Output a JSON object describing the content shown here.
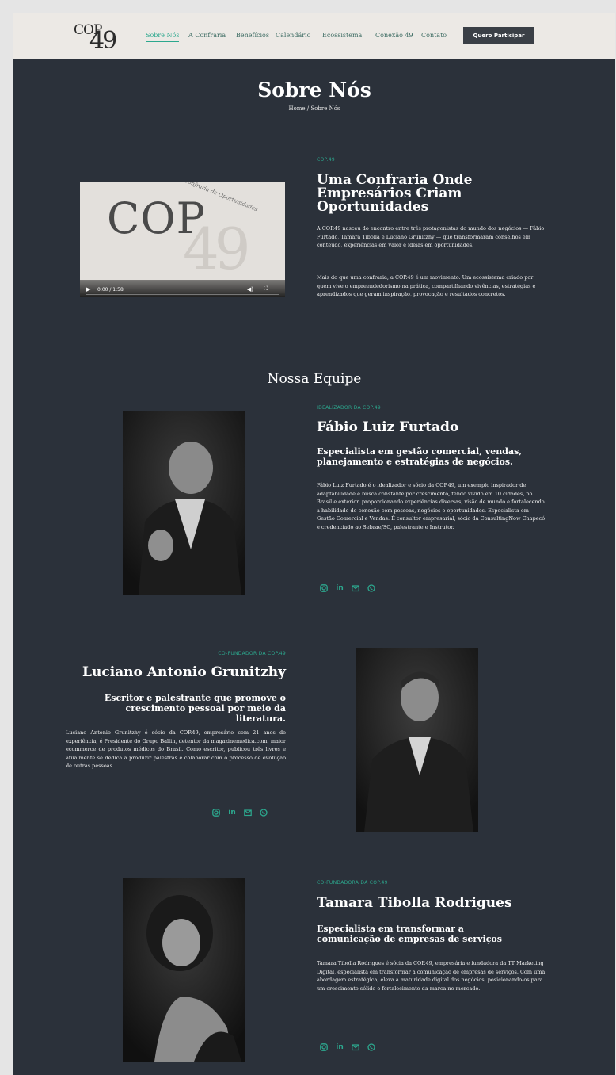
{
  "header": {
    "logo_top": "COP",
    "logo_num": "49",
    "nav": [
      "Sobre Nós",
      "A Confraria",
      "Benefícios",
      "Calendário",
      "Ecossistema",
      "Conexão 49",
      "Contato"
    ],
    "cta": "Quero Participar"
  },
  "hero": {
    "title": "Sobre Nós",
    "breadcrumb": "Home / Sobre Nós"
  },
  "about": {
    "video": {
      "brand_top": "COP",
      "brand_num": "49",
      "script": "Confraria de Oportunidades",
      "time": "0:00 / 1:58",
      "progress": 0
    },
    "eyebrow": "COP.49",
    "title": "Uma Confraria Onde Empresários Criam Oportunidades",
    "p1": "A COP.49 nasceu do encontro entre três protagonistas do mundo dos negócios — Fábio Furtado, Tamara Tibolla e Luciano Grunitzhy — que transformaram conselhos em conteúdo, experiências em valor e ideias em oportunidades.",
    "p2": "Mais do que uma confraria, a COP.49 é um movimento. Um ecossistema criado por quem vive o empreendedorismo na prática, compartilhando vivências, estratégias e aprendizados que geram inspiração, provocação e resultados concretos."
  },
  "team": {
    "title": "Nossa Equipe",
    "members": [
      {
        "role": "IDEALIZADOR DA COP.49",
        "name": "Fábio Luiz Furtado",
        "subtitle": "Especialista em gestão comercial, vendas, planejamento e estratégias de negócios.",
        "bio": "Fábio Luiz Furtado é o idealizador e sócio da COP.49, um exemplo inspirador de adaptabilidade e busca constante por crescimento, tendo vivido em 10 cidades, no Brasil e exterior, proporcionando experiências diversas, visão de mundo e fortalecendo a habilidade de conexão com pessoas, negócios e oportunidades. Especialista em Gestão Comercial e Vendas. É consultor empresarial, sócio da ConsultingNow Chapecó e credenciado ao Sebrae/SC, palestrante e Instrutor."
      },
      {
        "role": "CO-FUNDADOR DA COP.49",
        "name": "Luciano Antonio Grunitzhy",
        "subtitle": "Escritor e palestrante que promove o crescimento pessoal por meio da literatura.",
        "bio": "Luciano Antonio Grunitzhy é sócio da COP.49, empresário com 21 anos de experiência, é Presidente do Grupo Ballin, detentor da magazinemedica.com, maior ecommerce de produtos médicos do Brasil. Como escritor, publicou três livros e atualmente se dedica a produzir palestras e colaborar com o processo de evolução de outras pessoas."
      },
      {
        "role": "CO-FUNDADORA DA COP.49",
        "name": "Tamara Tibolla Rodrigues",
        "subtitle": "Especialista em transformar a comunicação de empresas de serviços",
        "bio": "Tamara Tibolla Rodrigues é sócia da COP.49, empresária e fundadora da TT Marketing Digital, especialista em transformar a comunicação de empresas de serviços. Com uma abordagem estratégica, eleva a maturidade digital dos negócios, posicionando-os para um crescimento sólido e fortalecimento da marca no mercado."
      }
    ],
    "social_icons": [
      "instagram-icon",
      "linkedin-icon",
      "email-icon",
      "whatsapp-icon"
    ],
    "accent": "#2ca88e"
  }
}
